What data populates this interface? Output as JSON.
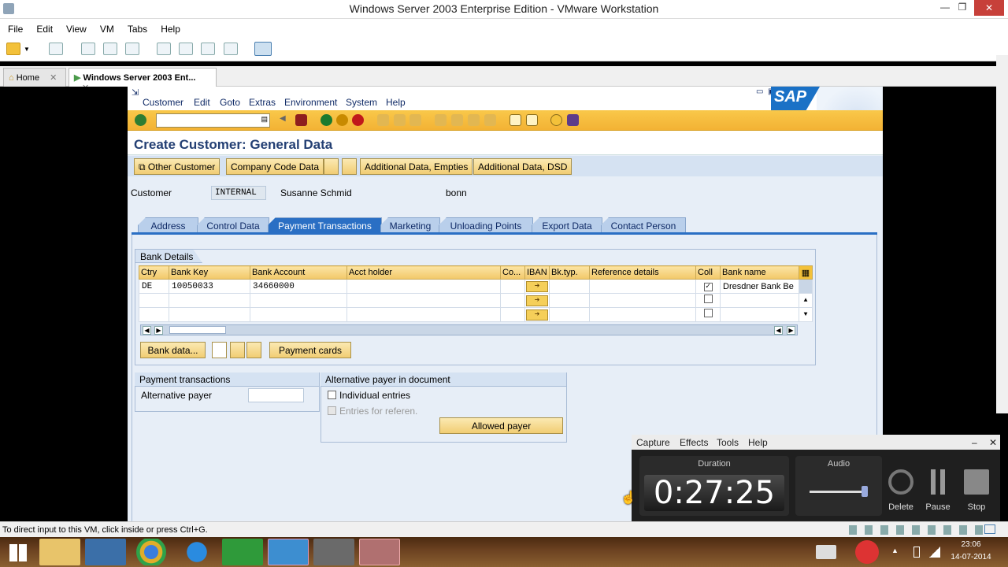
{
  "vmware": {
    "title": "Windows Server 2003 Enterprise Edition - VMware Workstation",
    "menu": [
      "File",
      "Edit",
      "View",
      "VM",
      "Tabs",
      "Help"
    ],
    "tabs": [
      {
        "label": "Home",
        "active": false
      },
      {
        "label": "Windows Server 2003 Ent...",
        "active": true
      }
    ],
    "status_text": "To direct input to this VM, click inside or press Ctrl+G."
  },
  "sap": {
    "menu": [
      "Customer",
      "Edit",
      "Goto",
      "Extras",
      "Environment",
      "System",
      "Help"
    ],
    "logo": "SAP",
    "page_title": "Create Customer: General Data",
    "app_toolbar": {
      "other_customer": "Other Customer",
      "company_code_data": "Company Code Data",
      "additional_data_empties": "Additional Data, Empties",
      "additional_data_dsd": "Additional Data, DSD"
    },
    "header": {
      "customer_label": "Customer",
      "customer_value": "INTERNAL",
      "name": "Susanne Schmid",
      "city": "bonn"
    },
    "tabs": [
      "Address",
      "Control Data",
      "Payment Transactions",
      "Marketing",
      "Unloading Points",
      "Export Data",
      "Contact Person"
    ],
    "active_tab": "Payment Transactions",
    "bank_details": {
      "title": "Bank Details",
      "columns": [
        "Ctry",
        "Bank Key",
        "Bank Account",
        "Acct holder",
        "Co...",
        "IBAN",
        "Bk.typ.",
        "Reference details",
        "Coll",
        "Bank name"
      ],
      "rows": [
        {
          "ctry": "DE",
          "bank_key": "10050033",
          "bank_account": "34660000",
          "acct_holder": "",
          "co": "",
          "bk_typ": "",
          "reference": "",
          "coll": true,
          "bank_name": "Dresdner Bank Be"
        },
        {
          "ctry": "",
          "bank_key": "",
          "bank_account": "",
          "acct_holder": "",
          "co": "",
          "bk_typ": "",
          "reference": "",
          "coll": false,
          "bank_name": ""
        },
        {
          "ctry": "",
          "bank_key": "",
          "bank_account": "",
          "acct_holder": "",
          "co": "",
          "bk_typ": "",
          "reference": "",
          "coll": false,
          "bank_name": ""
        }
      ],
      "bank_data_button": "Bank data...",
      "payment_cards_button": "Payment cards"
    },
    "payment_transactions": {
      "title": "Payment transactions",
      "alt_payer_label": "Alternative payer",
      "alt_payer_value": ""
    },
    "alt_payer_doc": {
      "title": "Alternative payer in document",
      "individual_entries": "Individual entries",
      "entries_for_reference": "Entries for referen.",
      "allowed_payer_button": "Allowed payer"
    }
  },
  "recorder": {
    "menu": [
      "Capture",
      "Effects",
      "Tools",
      "Help"
    ],
    "duration_label": "Duration",
    "duration": "0:27:25",
    "audio_label": "Audio",
    "delete_label": "Delete",
    "pause_label": "Pause",
    "stop_label": "Stop"
  },
  "taskbar": {
    "time": "23:06",
    "date": "14-07-2014"
  }
}
